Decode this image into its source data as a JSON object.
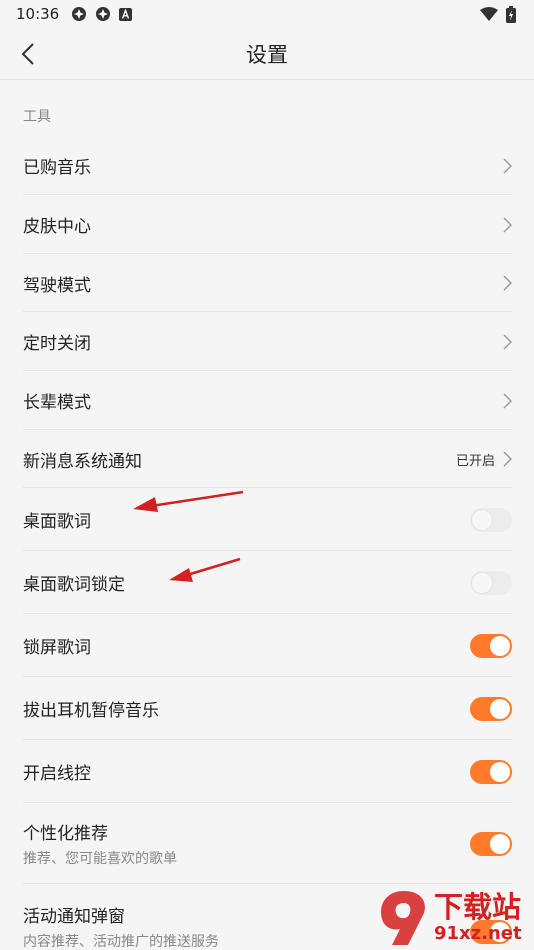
{
  "status_bar": {
    "time": "10:36"
  },
  "header": {
    "title": "设置"
  },
  "section": {
    "title": "工具"
  },
  "rows": [
    {
      "label": "已购音乐"
    },
    {
      "label": "皮肤中心"
    },
    {
      "label": "驾驶模式"
    },
    {
      "label": "定时关闭"
    },
    {
      "label": "长辈模式"
    },
    {
      "label": "新消息系统通知",
      "value": "已开启"
    },
    {
      "label": "桌面歌词",
      "toggle": "off"
    },
    {
      "label": "桌面歌词锁定",
      "toggle": "off"
    },
    {
      "label": "锁屏歌词",
      "toggle": "on"
    },
    {
      "label": "拔出耳机暂停音乐",
      "toggle": "on"
    },
    {
      "label": "开启线控",
      "toggle": "on"
    },
    {
      "label": "个性化推荐",
      "sub": "推荐、您可能喜欢的歌单",
      "toggle": "on"
    },
    {
      "label": "活动通知弹窗",
      "sub": "内容推荐、活动推广的推送服务",
      "toggle": "on"
    }
  ],
  "colors": {
    "accent": "#ff7a2b",
    "annotation": "#d32020"
  },
  "watermark": {
    "logo_text": "下载站",
    "url_text": "91xz.net"
  }
}
